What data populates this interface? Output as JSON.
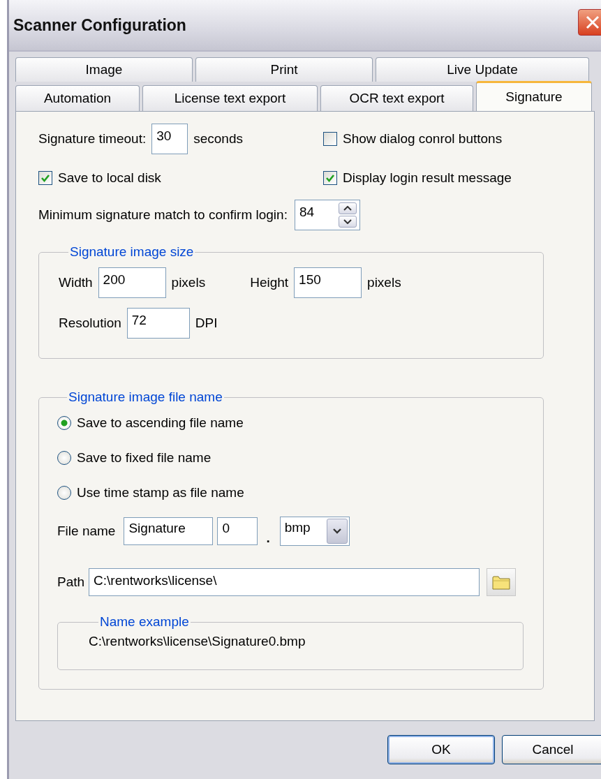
{
  "window": {
    "title": "Scanner Configuration"
  },
  "tab_rows": [
    {
      "tabs": [
        {
          "label": "Image",
          "selected": false
        },
        {
          "label": "Print",
          "selected": false
        },
        {
          "label": "Live Update",
          "selected": false
        }
      ]
    },
    {
      "tabs": [
        {
          "label": "Automation",
          "selected": false
        },
        {
          "label": "License text export",
          "selected": false
        },
        {
          "label": "OCR text export",
          "selected": false
        },
        {
          "label": "Signature",
          "selected": true
        }
      ]
    }
  ],
  "options": [
    {
      "kind": "number",
      "label": "Signature timeout:",
      "value": "30",
      "unit": "seconds"
    },
    {
      "kind": "checkbox",
      "label": "Show dialog conrol buttons",
      "checked": false
    },
    {
      "kind": "checkbox",
      "label": "Save to local disk",
      "checked": true
    },
    {
      "kind": "checkbox",
      "label": "Display login result message",
      "checked": true
    }
  ],
  "match": {
    "label": "Minimum signature match to confirm login:",
    "value": "84"
  },
  "image_size": {
    "legend": "Signature image size",
    "fields": [
      {
        "label": "Width",
        "value": "200",
        "unit": "pixels"
      },
      {
        "label": "Height",
        "value": "150",
        "unit": "pixels"
      },
      {
        "label": "Resolution",
        "value": "72",
        "unit": "DPI"
      }
    ]
  },
  "file_name_group": {
    "legend": "Signature image file name",
    "radios": [
      {
        "label": "Save to ascending file name",
        "selected": true
      },
      {
        "label": "Save to fixed file name",
        "selected": false
      },
      {
        "label": "Use time stamp as file  name",
        "selected": false
      }
    ],
    "file_name": {
      "label": "File name",
      "base": "Signature",
      "counter": "0",
      "separator": ".",
      "extension": "bmp"
    },
    "path": {
      "label": "Path",
      "value": "C:\\rentworks\\license\\"
    },
    "example": {
      "legend": "Name example",
      "text": "C:\\rentworks\\license\\Signature0.bmp"
    }
  },
  "buttons": [
    {
      "label": "OK",
      "default": true
    },
    {
      "label": "Cancel",
      "default": false
    }
  ]
}
